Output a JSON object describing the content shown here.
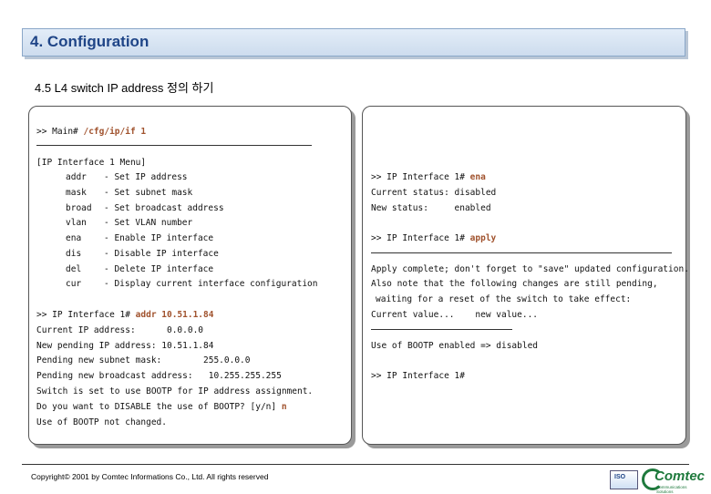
{
  "header": {
    "title": "4. Configuration"
  },
  "subtitle": "4.5 L4 switch IP address 정의 하기",
  "left_panel": {
    "prompt": ">> Main# ",
    "cmd1": "/cfg/ip/if 1",
    "menu_title": "[IP Interface 1 Menu]",
    "menu": [
      {
        "cmd": "addr",
        "desc": "- Set IP address"
      },
      {
        "cmd": "mask",
        "desc": "- Set subnet mask"
      },
      {
        "cmd": "broad",
        "desc": "- Set broadcast address"
      },
      {
        "cmd": "vlan",
        "desc": "- Set VLAN number"
      },
      {
        "cmd": "ena",
        "desc": "- Enable IP interface"
      },
      {
        "cmd": "dis",
        "desc": "- Disable IP interface"
      },
      {
        "cmd": "del",
        "desc": "- Delete IP interface"
      },
      {
        "cmd": "cur",
        "desc": "- Display current interface configuration"
      }
    ],
    "prompt2": ">> IP Interface 1# ",
    "cmd2": "addr 10.51.1.84",
    "line_current": "Current IP address:      0.0.0.0",
    "line_new": "New pending IP address: 10.51.1.84",
    "line_mask": "Pending new subnet mask:        255.0.0.0",
    "line_broad": "Pending new broadcast address:   10.255.255.255",
    "line_bootp": "Switch is set to use BOOTP for IP address assignment.",
    "line_disable": "Do you want to DISABLE the use of BOOTP? [y/n] ",
    "cmd3": "n",
    "line_unchanged": "Use of BOOTP not changed."
  },
  "right_panel": {
    "prompt1": ">> IP Interface 1# ",
    "cmd1": "ena",
    "status_current": "Current status: disabled",
    "status_new": "New status:     enabled",
    "prompt2": ">> IP Interface 1# ",
    "cmd2": "apply",
    "apply_complete": "Apply complete; don't forget to \"save\" updated configuration.",
    "also_note": "Also note that the following changes are still pending,",
    "waiting": "waiting for a reset of the switch to take effect:",
    "value_header": "Current value...    new value...",
    "bootp_change": "Use of BOOTP enabled => disabled",
    "prompt3": ">> IP Interface 1#"
  },
  "footer": {
    "copyright": "Copyright© 2001 by Comtec Informations Co., Ltd. All rights reserved"
  },
  "logo": {
    "text": "Comtec",
    "sub": "Communications Solutions",
    "badge": "ISO"
  }
}
